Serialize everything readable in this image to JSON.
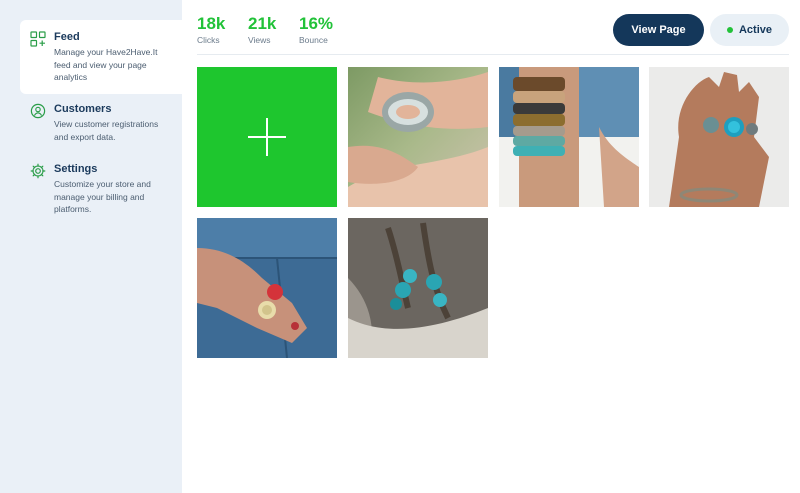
{
  "sidebar": {
    "items": [
      {
        "title": "Feed",
        "desc": "Manage your Have2Have.It feed and view your page analytics",
        "icon": "grid-icon"
      },
      {
        "title": "Customers",
        "desc": "View customer registrations and export data.",
        "icon": "user-icon"
      },
      {
        "title": "Settings",
        "desc": "Customize your store and manage your billing and platforms.",
        "icon": "gear-icon"
      }
    ]
  },
  "stats": [
    {
      "value": "18k",
      "label": "Clicks"
    },
    {
      "value": "21k",
      "label": "Views"
    },
    {
      "value": "16%",
      "label": "Bounce"
    }
  ],
  "header": {
    "view_page_label": "View Page",
    "status_label": "Active"
  },
  "colors": {
    "accent_green": "#22c239",
    "navy": "#14375a",
    "sidebar_bg": "#eaf0f7"
  },
  "feed": {
    "add_icon": "plus-icon",
    "photos": [
      "bracelet-arm-photo",
      "stacked-bangles-photo",
      "turquoise-rings-hand-photo",
      "denim-rose-rings-photo",
      "turquoise-necklace-photo"
    ]
  }
}
